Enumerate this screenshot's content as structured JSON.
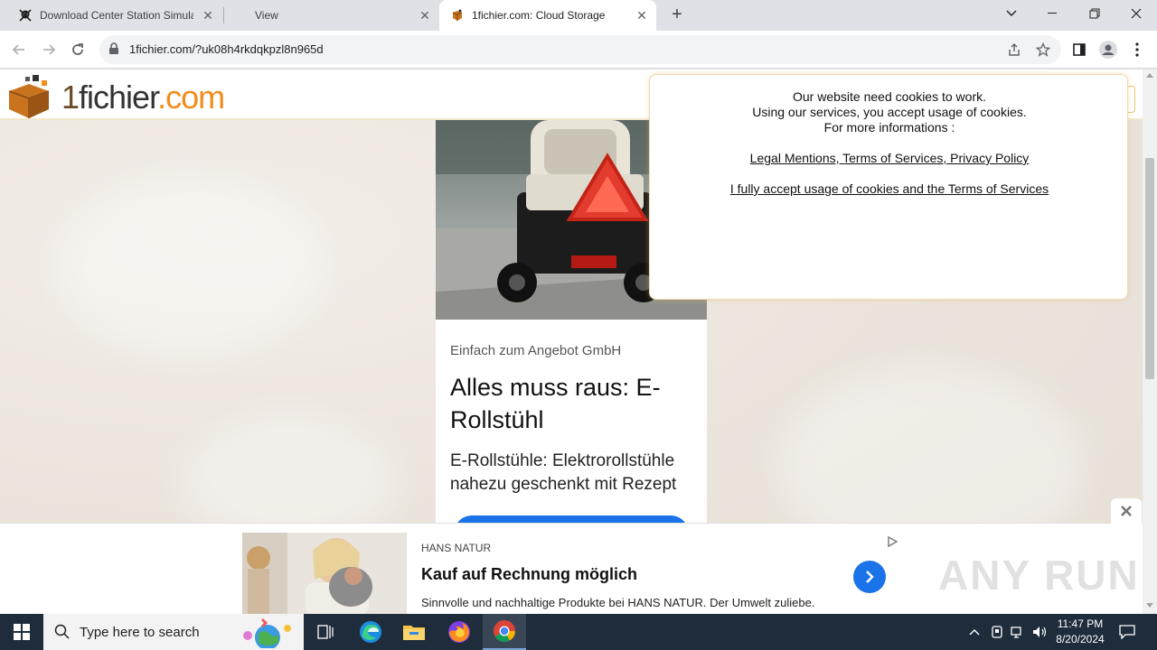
{
  "browser": {
    "tabs": [
      {
        "title": "Download Center Station Simula",
        "icon": "skull-crossbones-icon",
        "active": false
      },
      {
        "title": "View",
        "icon": "none",
        "active": false
      },
      {
        "title": "1fichier.com: Cloud Storage",
        "icon": "1fichier-favicon",
        "active": true
      }
    ],
    "new_tab": "+",
    "url": "1fichier.com/?uk08h4rkdqkpzl8n965d"
  },
  "site": {
    "logo": {
      "part1": "1",
      "part2": "fichier",
      "part3": ".com"
    }
  },
  "ad_card": {
    "brand": "Einfach zum Angebot GmbH",
    "headline": "Alles muss raus: E-Rollstühl",
    "body": "E-Rollstühle: Elektrorollstühle nahezu geschenkt mit Rezept"
  },
  "cookie_notice": {
    "line1": "Our website need cookies to work.",
    "line2": "Using our services, you accept usage of cookies.",
    "line3": "For more informations :",
    "legal_link": "Legal Mentions, Terms of Services, Privacy Policy",
    "accept_link": "I fully accept usage of cookies and the Terms of Services"
  },
  "bottom_ad": {
    "brand": "HANS NATUR",
    "headline": "Kauf auf Rechnung möglich",
    "description": "Sinnvolle und nachhaltige Produkte bei HANS NATUR. Der Umwelt zuliebe.",
    "watermark": "ANY RUN"
  },
  "taskbar": {
    "search_placeholder": "Type here to search",
    "time": "11:47 PM",
    "date": "8/20/2024"
  },
  "colors": {
    "accent_blue": "#1a73e8",
    "logo_orange": "#f28c1b",
    "taskbar": "#1f2c3b"
  }
}
